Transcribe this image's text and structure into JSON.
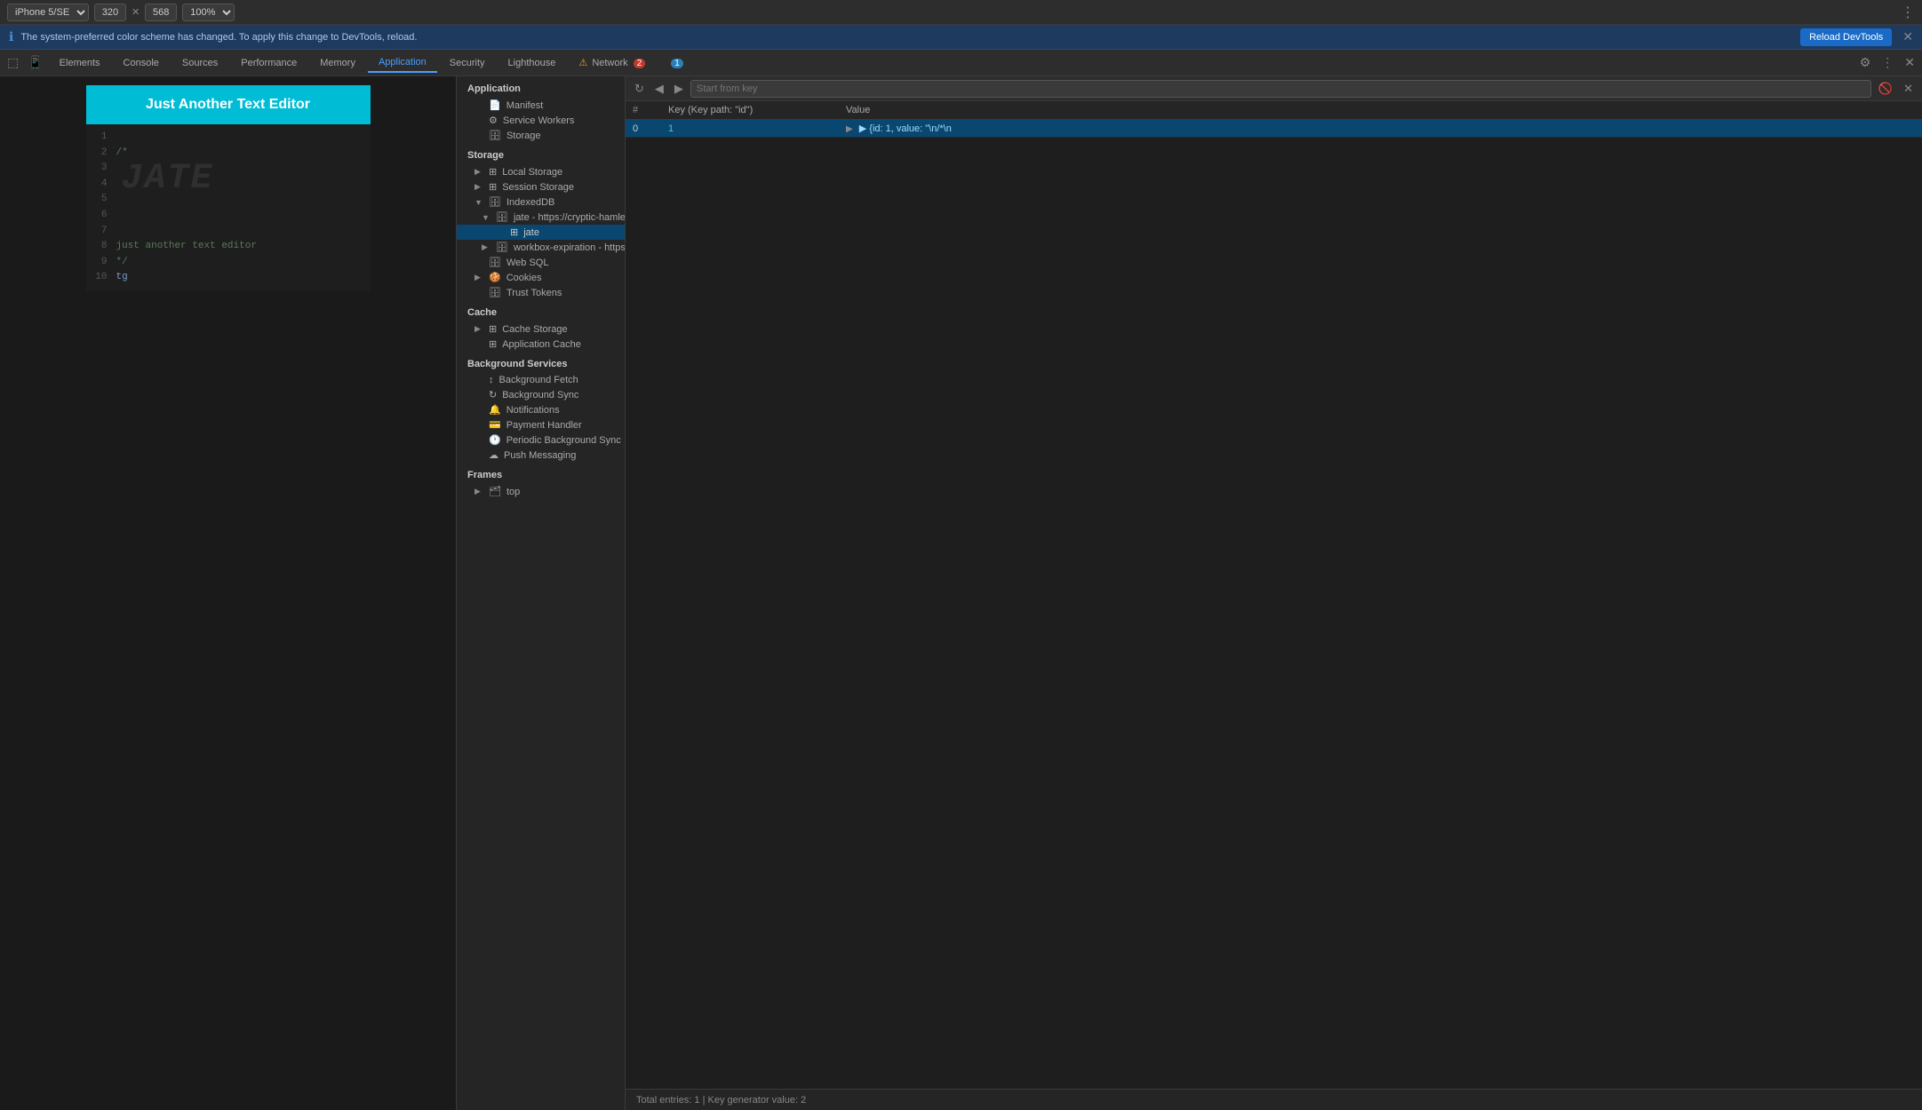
{
  "topBar": {
    "device": "iPhone 5/SE",
    "width": "320",
    "height": "568",
    "zoom": "100%",
    "moreLabel": "⋮"
  },
  "infoBar": {
    "icon": "ℹ",
    "text": "The system-preferred color scheme has changed. To apply this change to DevTools, reload.",
    "reloadLabel": "Reload DevTools",
    "closeIcon": "✕"
  },
  "tabs": [
    {
      "id": "elements",
      "label": "Elements"
    },
    {
      "id": "console",
      "label": "Console"
    },
    {
      "id": "sources",
      "label": "Sources"
    },
    {
      "id": "performance",
      "label": "Performance"
    },
    {
      "id": "memory",
      "label": "Memory"
    },
    {
      "id": "application",
      "label": "Application",
      "active": true
    },
    {
      "id": "security",
      "label": "Security"
    },
    {
      "id": "lighthouse",
      "label": "Lighthouse"
    },
    {
      "id": "network",
      "label": "Network",
      "warn": true,
      "badge": "2"
    },
    {
      "id": "tab2",
      "label": "",
      "blueBadge": "1"
    }
  ],
  "app": {
    "title": "Just Another Text Editor",
    "watermark": "JATE",
    "lines": [
      {
        "num": "1",
        "content": "",
        "type": "normal"
      },
      {
        "num": "2",
        "content": "/*",
        "type": "comment"
      },
      {
        "num": "3",
        "content": "",
        "type": "normal"
      },
      {
        "num": "4",
        "content": "",
        "type": "normal"
      },
      {
        "num": "5",
        "content": "",
        "type": "normal"
      },
      {
        "num": "6",
        "content": "",
        "type": "normal"
      },
      {
        "num": "7",
        "content": "",
        "type": "normal"
      },
      {
        "num": "8",
        "content": "just another text editor",
        "type": "comment"
      },
      {
        "num": "9",
        "content": "*/",
        "type": "comment"
      },
      {
        "num": "10",
        "content": "tg",
        "type": "normal"
      }
    ]
  },
  "sidebar": {
    "appSection": "Application",
    "manifestLabel": "Manifest",
    "serviceWorkersLabel": "Service Workers",
    "storageLabel": "Storage",
    "storageSection": "Storage",
    "localStorageLabel": "Local Storage",
    "sessionStorageLabel": "Session Storage",
    "indexedDbLabel": "IndexedDB",
    "jateDbLabel": "jate - https://cryptic-hamlet",
    "jateLabel": "jate",
    "workboxLabel": "workbox-expiration - https:",
    "webSqlLabel": "Web SQL",
    "cookiesLabel": "Cookies",
    "trustTokensLabel": "Trust Tokens",
    "cacheSection": "Cache",
    "cacheStorageLabel": "Cache Storage",
    "appCacheLabel": "Application Cache",
    "bgSection": "Background Services",
    "bgFetchLabel": "Background Fetch",
    "bgSyncLabel": "Background Sync",
    "notificationsLabel": "Notifications",
    "paymentHandlerLabel": "Payment Handler",
    "periodicBgSyncLabel": "Periodic Background Sync",
    "pushMessagingLabel": "Push Messaging",
    "framesSection": "Frames",
    "topLabel": "top"
  },
  "dataPanel": {
    "searchPlaceholder": "Start from key",
    "columns": [
      "#",
      "Key (Key path: \"id\")",
      "Value"
    ],
    "rows": [
      {
        "num": "0",
        "key": "1",
        "value": "▶ {id: 1, value: \"\\n/*\\n"
      }
    ],
    "statusText": "Total entries: 1  |  Key generator value: 2"
  }
}
